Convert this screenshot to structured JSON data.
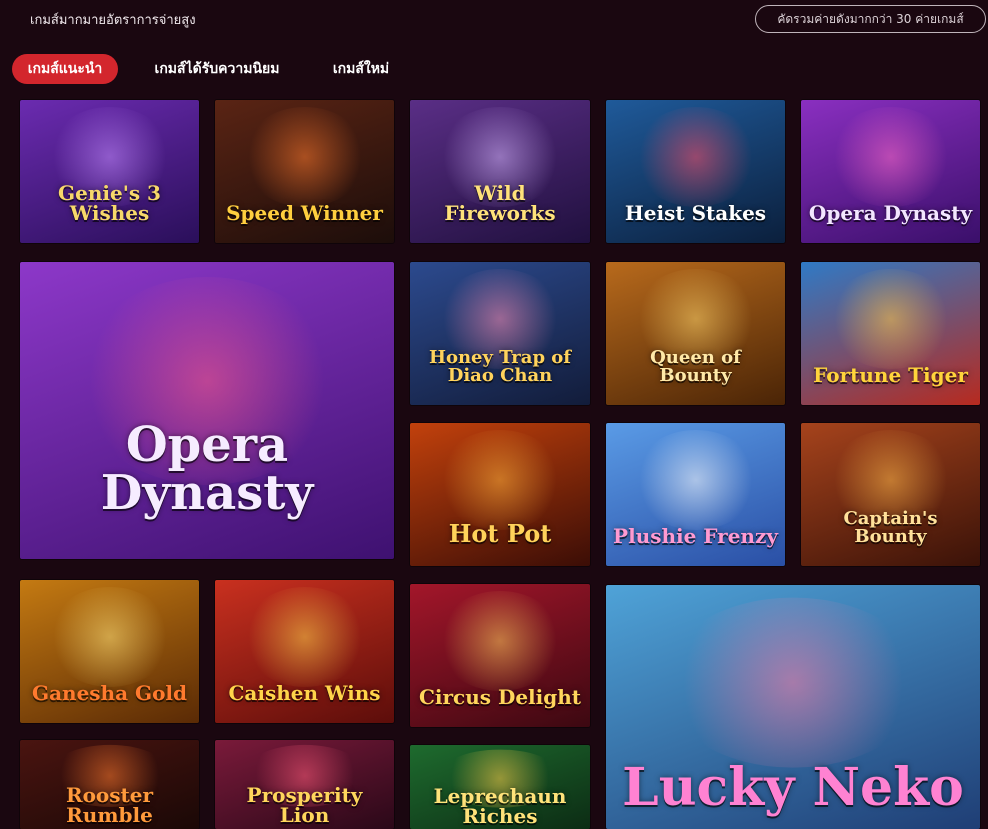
{
  "header": {
    "title": "เกมส์มากมายอัตราการจ่ายสูง",
    "badge": "คัดรวมค่ายดังมากกว่า 30 ค่ายเกมส์"
  },
  "tabs": [
    {
      "label": "เกมส์แนะนำ",
      "active": true
    },
    {
      "label": "เกมส์ได้รับความนิยม",
      "active": false
    },
    {
      "label": "เกมส์ใหม่",
      "active": false
    }
  ],
  "games": [
    {
      "name": "Genie's 3 Wishes",
      "colors": [
        "#6b2bb0",
        "#2a0f5a"
      ],
      "glow": "#c48bff",
      "text": "#f7d86a"
    },
    {
      "name": "Speed Winner",
      "colors": [
        "#5a2414",
        "#1c0d0a"
      ],
      "glow": "#ff7a2e",
      "text": "#ffcf3f"
    },
    {
      "name": "Wild Fireworks",
      "colors": [
        "#5a2e86",
        "#20103e"
      ],
      "glow": "#d7b6ff",
      "text": "#ffe27a"
    },
    {
      "name": "Heist Stakes",
      "colors": [
        "#1f5a9a",
        "#0b1f3c"
      ],
      "glow": "#ff4f6a",
      "text": "#ffffff"
    },
    {
      "name": "Opera Dynasty",
      "colors": [
        "#8a2fc0",
        "#3a0f6a"
      ],
      "glow": "#ff6bc8",
      "text": "#f3e6ff"
    },
    {
      "name": "Opera Dynasty",
      "colors": [
        "#8d38c9",
        "#3e1170"
      ],
      "glow": "#ff5c8a",
      "text": "#f6ecff"
    },
    {
      "name": "Honey Trap of Diao Chan",
      "colors": [
        "#2c4a8e",
        "#121c3a"
      ],
      "glow": "#ff8fb7",
      "text": "#ffd35c"
    },
    {
      "name": "Queen of Bounty",
      "colors": [
        "#b86a1c",
        "#4a2406"
      ],
      "glow": "#ffd56b",
      "text": "#ffe9a8"
    },
    {
      "name": "Fortune Tiger",
      "colors": [
        "#2f7ac6",
        "#b72a1f"
      ],
      "glow": "#ffcb4a",
      "text": "#ffd43b"
    },
    {
      "name": "Hot Pot",
      "colors": [
        "#c2410c",
        "#3b0d06"
      ],
      "glow": "#ffb13b",
      "text": "#ffd25a"
    },
    {
      "name": "Plushie Frenzy",
      "colors": [
        "#5a9be6",
        "#2a4fa5"
      ],
      "glow": "#ffffff",
      "text": "#ff9ad1"
    },
    {
      "name": "Captain's Bounty",
      "colors": [
        "#a6431c",
        "#3a1208"
      ],
      "glow": "#ffb84a",
      "text": "#ffe19a"
    },
    {
      "name": "Ganesha Gold",
      "colors": [
        "#c47a12",
        "#5a2a05"
      ],
      "glow": "#ffe27a",
      "text": "#ff7a2e"
    },
    {
      "name": "Caishen Wins",
      "colors": [
        "#c9301f",
        "#5c0d0a"
      ],
      "glow": "#ffd04a",
      "text": "#ffd44a"
    },
    {
      "name": "Circus Delight",
      "colors": [
        "#a3162a",
        "#3c0811"
      ],
      "glow": "#ffcc5c",
      "text": "#ffd65c"
    },
    {
      "name": "Lucky Neko",
      "colors": [
        "#4fa3d8",
        "#1f3e75"
      ],
      "glow": "#ff7ea8",
      "text": "#ff82d2"
    },
    {
      "name": "Rooster Rumble",
      "colors": [
        "#4a1410",
        "#1a0806"
      ],
      "glow": "#ff7a2e",
      "text": "#ff9a3c"
    },
    {
      "name": "Prosperity Lion",
      "colors": [
        "#7a1a3a",
        "#2a0818"
      ],
      "glow": "#ff5a7a",
      "text": "#ffd65c"
    },
    {
      "name": "Leprechaun Riches",
      "colors": [
        "#1e6b2e",
        "#0c2c14"
      ],
      "glow": "#ffd04a",
      "text": "#ffe27a"
    }
  ]
}
